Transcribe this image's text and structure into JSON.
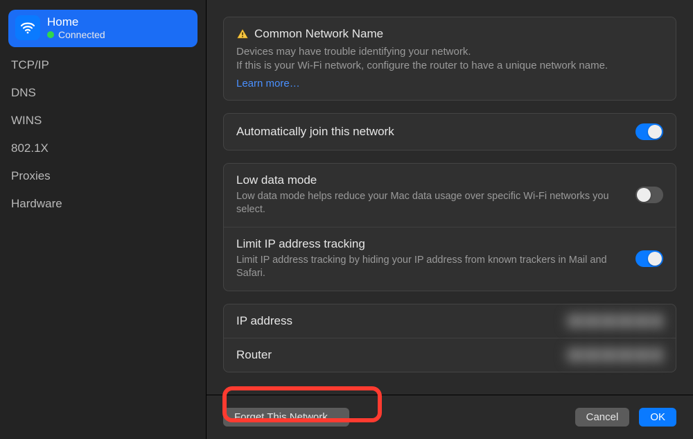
{
  "sidebar": {
    "network": {
      "name": "Home",
      "status": "Connected"
    },
    "items": [
      {
        "label": "TCP/IP"
      },
      {
        "label": "DNS"
      },
      {
        "label": "WINS"
      },
      {
        "label": "802.1X"
      },
      {
        "label": "Proxies"
      },
      {
        "label": "Hardware"
      }
    ]
  },
  "warning": {
    "title": "Common Network Name",
    "line1": "Devices may have trouble identifying your network.",
    "line2": "If this is your Wi-Fi network, configure the router to have a unique network name.",
    "learn": "Learn more…"
  },
  "auto_join": {
    "title": "Automatically join this network",
    "on": true
  },
  "low_data": {
    "title": "Low data mode",
    "desc": "Low data mode helps reduce your Mac data usage over specific Wi-Fi networks you select.",
    "on": false
  },
  "limit_ip": {
    "title": "Limit IP address tracking",
    "desc": "Limit IP address tracking by hiding your IP address from known trackers in Mail and Safari.",
    "on": true
  },
  "info": {
    "ip_label": "IP address",
    "router_label": "Router"
  },
  "buttons": {
    "forget": "Forget This Network…",
    "cancel": "Cancel",
    "ok": "OK"
  }
}
